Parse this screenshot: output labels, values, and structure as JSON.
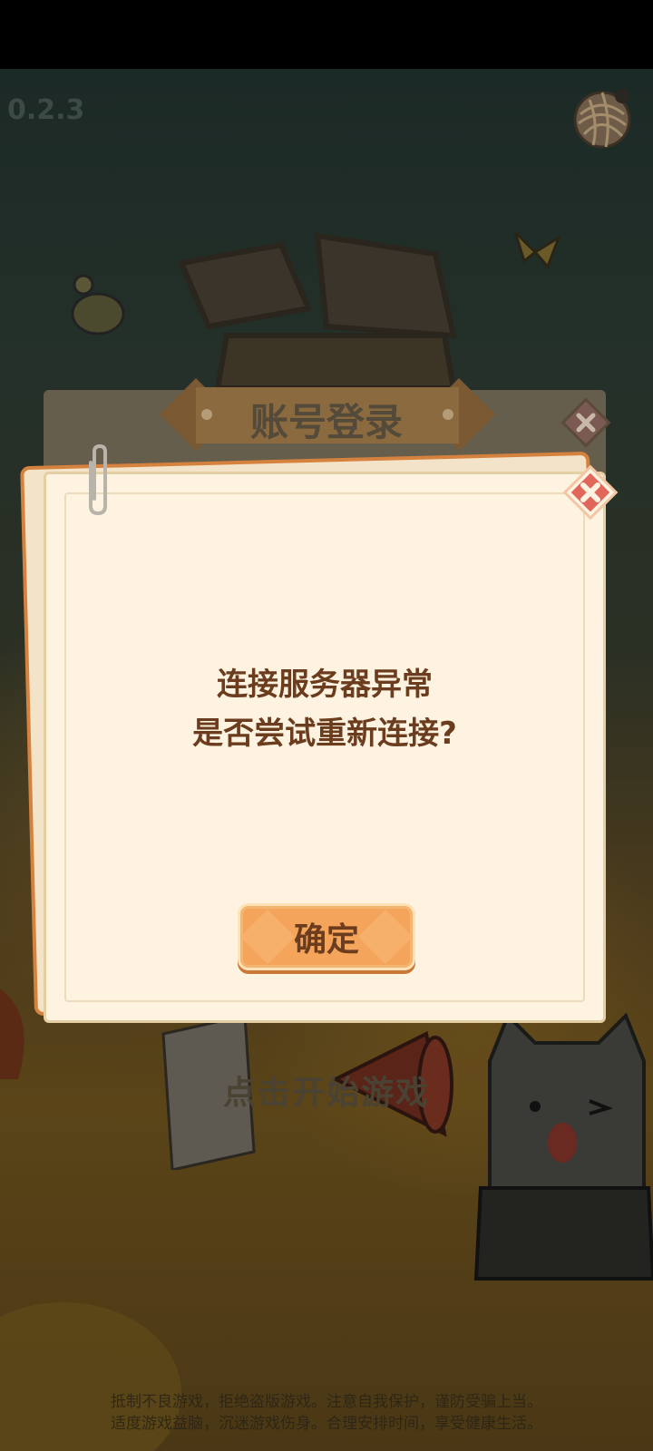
{
  "status_bar": {},
  "hud": {
    "version": "0.2.3",
    "settings_icon": "yarn-ball-icon"
  },
  "background": {
    "logo_alt_icon": "game-logo-icon",
    "start_prompt": "点击开始游戏",
    "health_notice": [
      "抵制不良游戏，拒绝盗版游戏。注意自我保护，谨防受骗上当。",
      "适度游戏益脑，沉迷游戏伤身。合理安排时间，享受健康生活。"
    ]
  },
  "login_panel": {
    "title": "账号登录",
    "close_icon": "close-icon"
  },
  "dialog": {
    "message_lines": [
      "连接服务器异常",
      "是否尝试重新连接?"
    ],
    "confirm_label": "确定",
    "close_icon": "close-icon"
  },
  "colors": {
    "dialog_text": "#6b3c1d",
    "button": "#f5a45b",
    "close_red": "#e0675a"
  }
}
